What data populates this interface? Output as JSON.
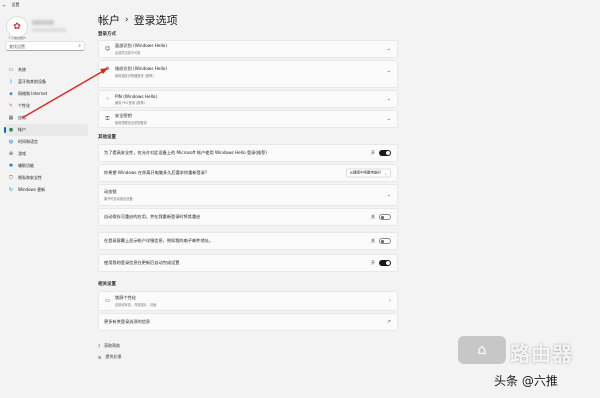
{
  "window": {
    "back_glyph": "←",
    "title": "设置"
  },
  "profile": {
    "avatar_glyph": "✿",
    "caption": "个人信息账户"
  },
  "search": {
    "placeholder": "查找设置",
    "icon": "search-icon"
  },
  "nav": [
    {
      "label": "系统",
      "icon": "monitor-icon",
      "color": "#0078d4",
      "active": false
    },
    {
      "label": "蓝牙和其他设备",
      "icon": "bluetooth-icon",
      "color": "#0078d4",
      "active": false
    },
    {
      "label": "网络和 Internet",
      "icon": "wifi-icon",
      "color": "#1c6fb8",
      "active": false
    },
    {
      "label": "个性化",
      "icon": "brush-icon",
      "color": "#c9772a",
      "active": false
    },
    {
      "label": "应用",
      "icon": "apps-icon",
      "color": "#555555",
      "active": false
    },
    {
      "label": "帐户",
      "icon": "person-icon",
      "color": "#2e8b57",
      "active": true
    },
    {
      "label": "时间和语言",
      "icon": "globe-icon",
      "color": "#0078d4",
      "active": false
    },
    {
      "label": "游戏",
      "icon": "gamepad-icon",
      "color": "#444444",
      "active": false
    },
    {
      "label": "辅助功能",
      "icon": "accessibility-icon",
      "color": "#0078d4",
      "active": false
    },
    {
      "label": "隐私和安全性",
      "icon": "shield-icon",
      "color": "#555555",
      "active": false
    },
    {
      "label": "Windows 更新",
      "icon": "update-icon",
      "color": "#0078d4",
      "active": false
    }
  ],
  "header": {
    "parent": "帐户",
    "separator": "›",
    "current": "登录选项"
  },
  "sections": {
    "signin_title": "登录方式",
    "additional_title": "其他设置",
    "related_title": "相关设置"
  },
  "signin_methods": [
    {
      "title": "面部识别 (Windows Hello)",
      "sub": "此选项当前不可用",
      "icon": "face-icon"
    },
    {
      "title": "指纹识别 (Windows Hello)",
      "sub": "使用指纹识别器登录 (推荐)",
      "icon": "fingerprint-icon"
    },
    {
      "title": "PIN (Windows Hello)",
      "sub": "使用 PIN 登录 (推荐)",
      "icon": "pin-icon"
    },
    {
      "title": "安全密钥",
      "sub": "使用物理安全密钥登录",
      "icon": "key-icon"
    }
  ],
  "additional": [
    {
      "title": "为了提高安全性，仅允许对此设备上的 Microsoft 帐户使用 Windows Hello 登录(推荐)",
      "state": "开",
      "toggle": "on"
    },
    {
      "title": "你希望 Windows 在你离开电脑多久后要求你重新登录?",
      "dropdown": "从睡眠中唤醒电脑时"
    },
    {
      "title": "动态锁",
      "sub": "离开时自动锁定设备"
    },
    {
      "title": "自动保存可重启的应用，并在我重新登录时将其重启",
      "state": "关",
      "toggle": "off"
    },
    {
      "title": "在登录屏幕上显示帐户详细信息，例如我的电子邮件地址。",
      "state": "关",
      "toggle": "off"
    },
    {
      "title": "使用我的登录信息在更新后自动完成设置",
      "state": "开",
      "toggle": "on"
    }
  ],
  "related": [
    {
      "title": "锁屏个性化",
      "sub": "应用和状态、背景图片、动画",
      "icon": "lock-screen-icon",
      "action": "›"
    },
    {
      "title": "更多有关登录选项的信息",
      "action": "↗"
    }
  ],
  "footer": [
    {
      "label": "获取帮助",
      "icon": "help-icon"
    },
    {
      "label": "提供反馈",
      "icon": "feedback-icon"
    }
  ],
  "watermark": {
    "badge": "⌂",
    "name": "路由器",
    "author": "头条 @六推"
  },
  "colors": {
    "accent": "#0067c0",
    "arrow": "#e0261b"
  }
}
